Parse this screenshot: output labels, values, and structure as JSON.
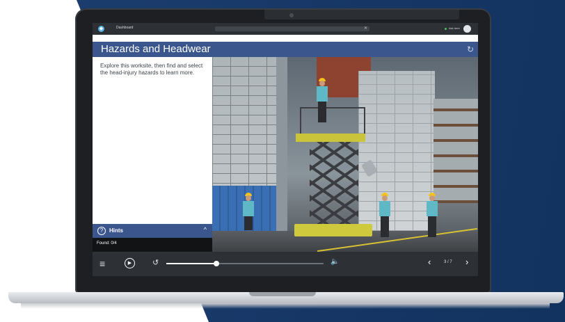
{
  "browser": {
    "tab_label": "Dashboard",
    "user_name": "Ask here"
  },
  "lesson": {
    "title": "Hazards and Headwear",
    "intro": "Explore this worksite, then find and select the head-injury hazards to learn more."
  },
  "hints": {
    "label": "Hints",
    "found_text": "Found: 0/4"
  },
  "player": {
    "progress": 0.32,
    "page_indicator": "3 / 7"
  },
  "icons": {
    "app": "app-logo-icon",
    "refresh": "refresh-icon",
    "hints": "question-circle-icon",
    "chevron": "chevron-up-icon",
    "menu": "hamburger-menu-icon",
    "play": "play-icon",
    "replay": "replay-icon",
    "volume": "volume-icon",
    "prev": "chevron-left-icon",
    "next": "chevron-right-icon"
  },
  "colors": {
    "accent": "#3a568d",
    "background_navy": "#1b3d6e",
    "hard_hat": "#f4c21a",
    "shirt": "#5fb8c6"
  }
}
